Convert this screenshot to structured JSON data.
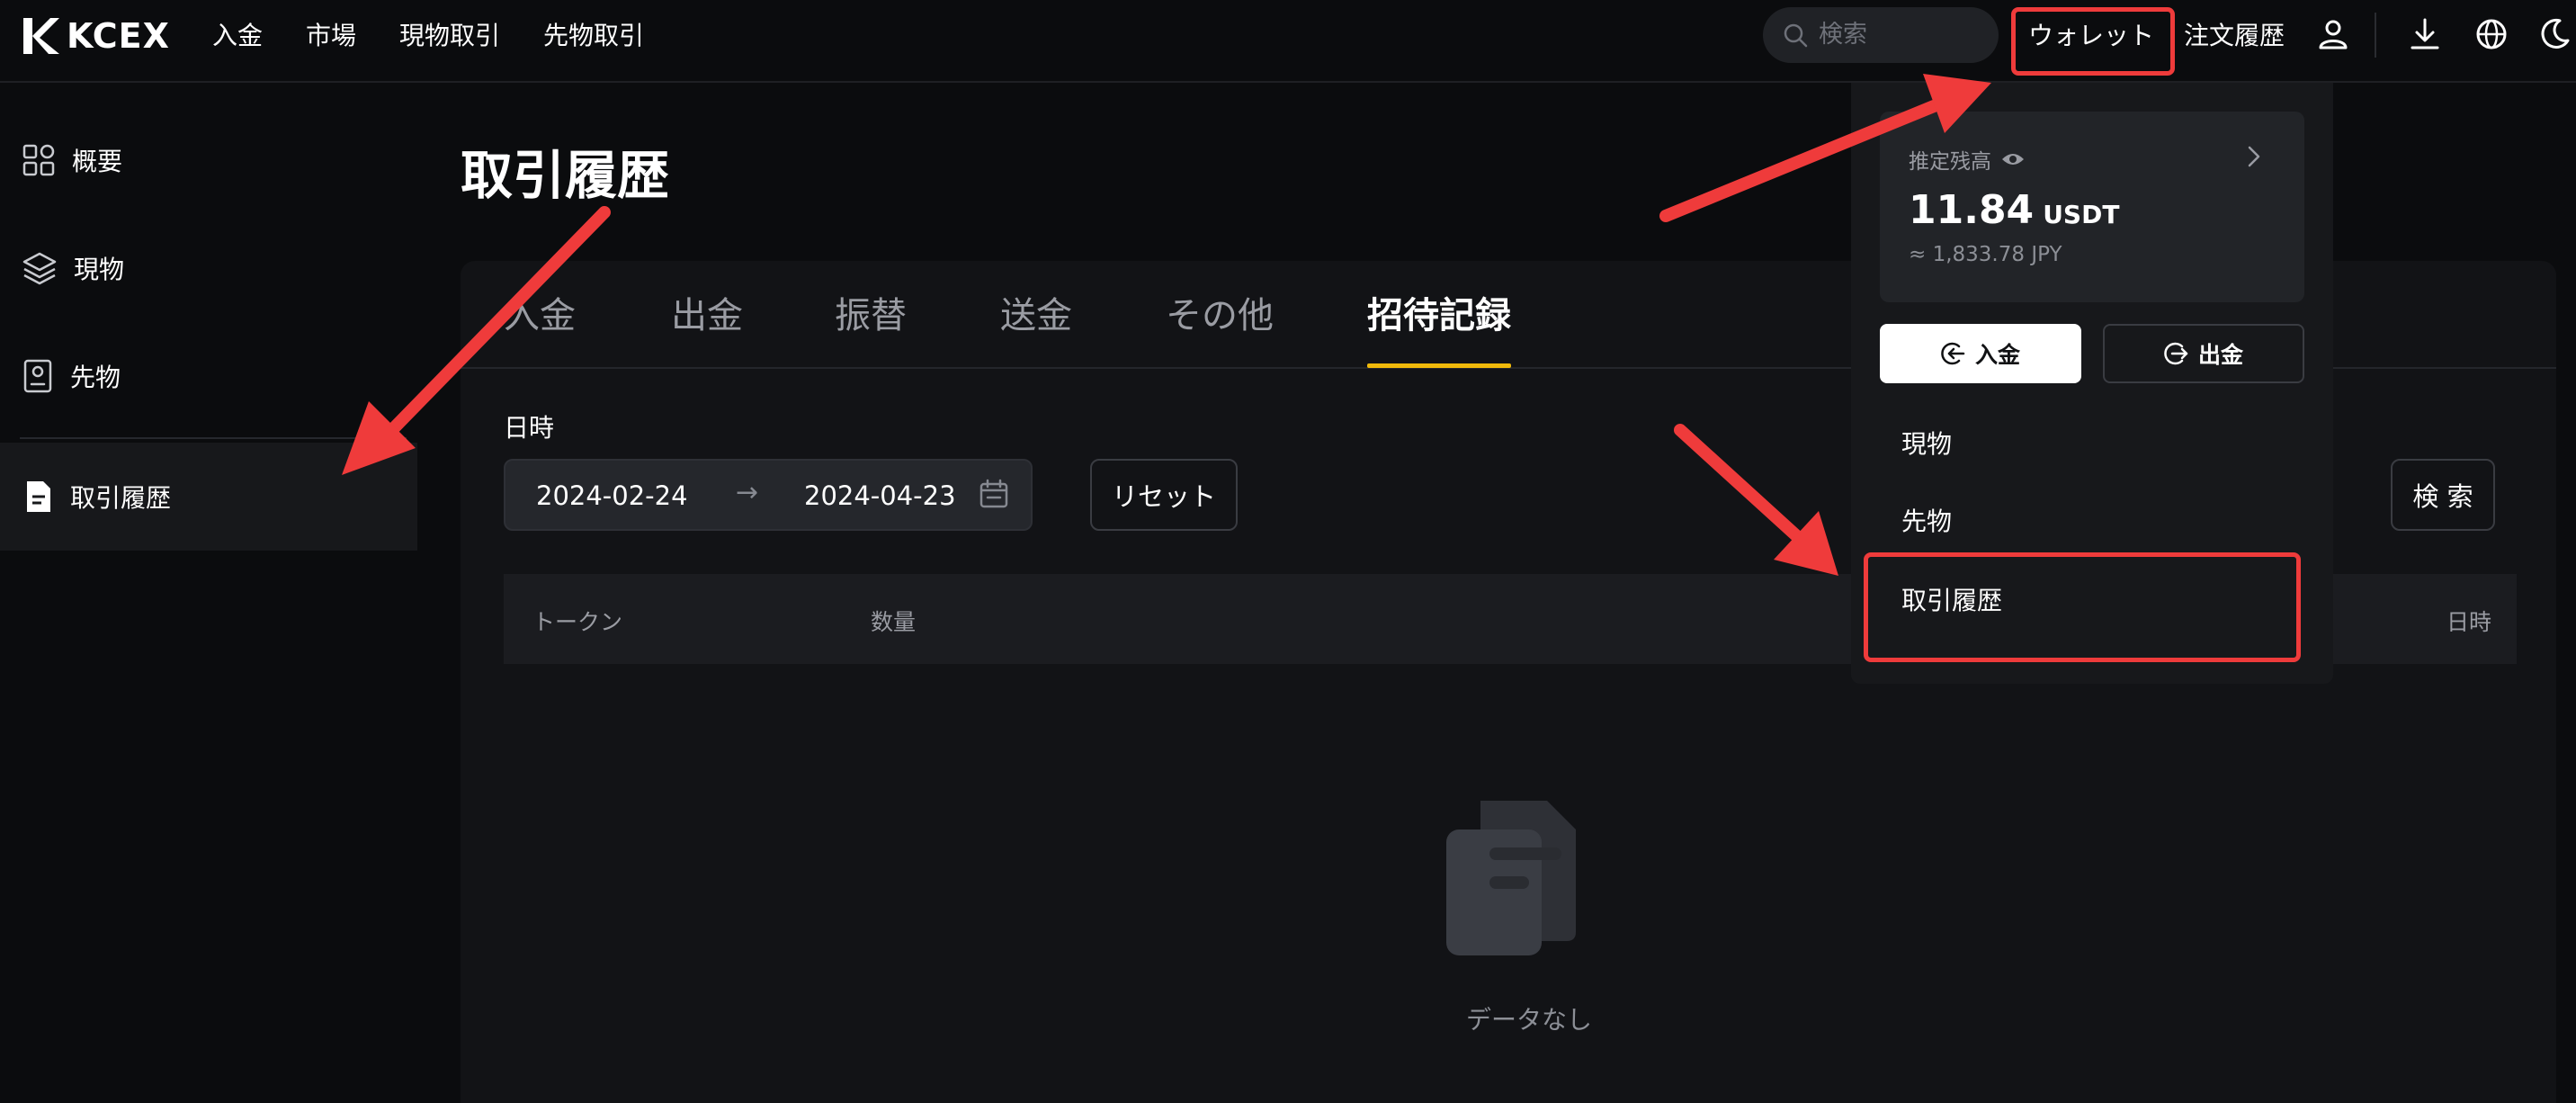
{
  "header": {
    "logo_text": "KCEX",
    "nav": [
      "入金",
      "市場",
      "現物取引",
      "先物取引"
    ],
    "search_placeholder": "検索",
    "wallet_label": "ウォレット",
    "orders_label": "注文履歴"
  },
  "sidebar": {
    "items": [
      {
        "label": "概要",
        "icon": "overview-grid-icon"
      },
      {
        "label": "現物",
        "icon": "layers-icon"
      },
      {
        "label": "先物",
        "icon": "document-badge-icon"
      },
      {
        "label": "取引履歴",
        "icon": "file-icon"
      }
    ],
    "active_index": 3
  },
  "main": {
    "title": "取引履歴",
    "tabs": [
      "入金",
      "出金",
      "振替",
      "送金",
      "その他",
      "招待記録"
    ],
    "active_tab": "招待記録",
    "filter": {
      "date_label": "日時",
      "start_date": "2024-02-24",
      "end_date": "2024-04-23",
      "reset_label": "リセット",
      "search_label": "検 索"
    },
    "table": {
      "columns": [
        "トークン",
        "数量",
        "日時"
      ]
    },
    "empty_text": "データなし"
  },
  "wallet_dropdown": {
    "balance_label": "推定残高",
    "balance_value": "11.84",
    "balance_unit": "USDT",
    "balance_fiat": "≈ 1,833.78 JPY",
    "deposit_label": "入金",
    "withdraw_label": "出金",
    "items": [
      "現物",
      "先物",
      "取引履歴"
    ]
  },
  "colors": {
    "background": "#0b0c0e",
    "accent": "#f0b90b",
    "annotation": "#ef3b3b"
  }
}
